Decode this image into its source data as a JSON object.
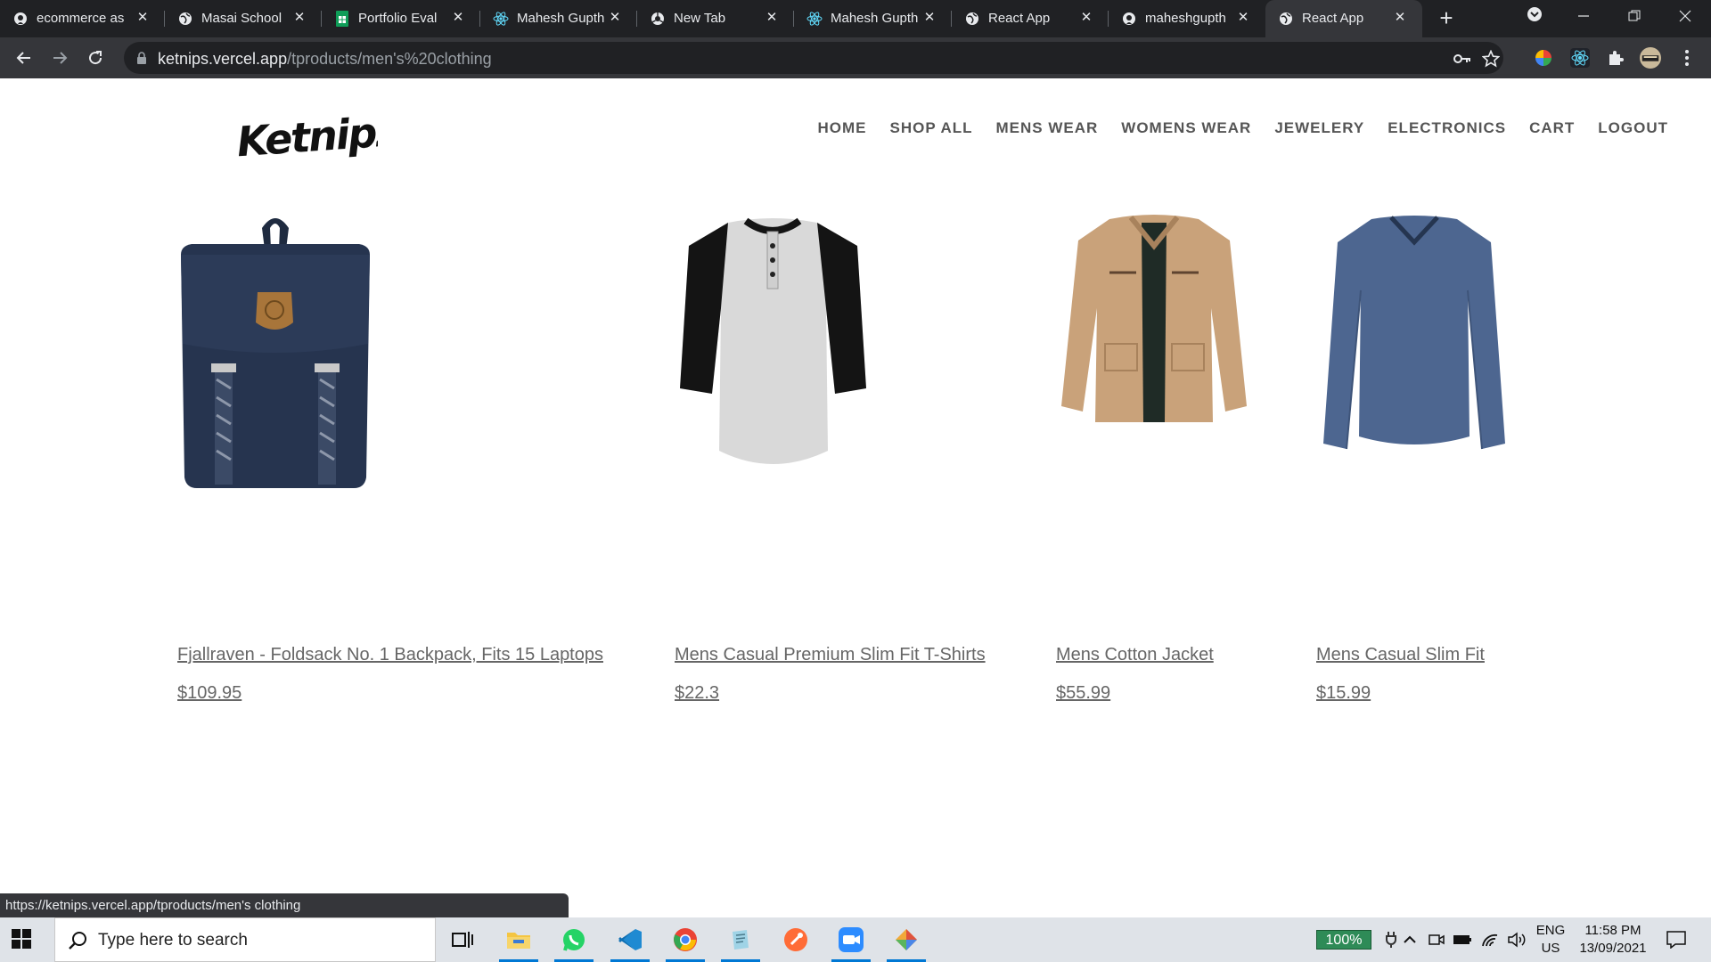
{
  "browser": {
    "tabs": [
      {
        "title": "ecommerce as",
        "favicon": "github-icon"
      },
      {
        "title": "Masai School",
        "favicon": "globe-icon"
      },
      {
        "title": "Portfolio Eval",
        "favicon": "sheets-icon"
      },
      {
        "title": "Mahesh Gupth",
        "favicon": "react-icon"
      },
      {
        "title": "New Tab",
        "favicon": "chrome-icon"
      },
      {
        "title": "Mahesh Gupth",
        "favicon": "react-icon"
      },
      {
        "title": "React App",
        "favicon": "globe-icon"
      },
      {
        "title": "maheshgupth",
        "favicon": "github-icon"
      },
      {
        "title": "React App",
        "favicon": "globe-icon",
        "active": true
      }
    ],
    "url_host": "ketnips.vercel.app",
    "url_path": "/tproducts/men's%20clothing",
    "status_url": "https://ketnips.vercel.app/tproducts/men's clothing"
  },
  "site": {
    "logo_text": "Ketnipz",
    "nav": [
      "HOME",
      "SHOP ALL",
      "MENS WEAR",
      "WOMENS WEAR",
      "JEWELERY",
      "ELECTRONICS",
      "CART",
      "LOGOUT"
    ]
  },
  "products": [
    {
      "name": "Fjallraven - Foldsack No. 1 Backpack, Fits 15 Laptops",
      "price": "$109.95",
      "image": "navy-backpack"
    },
    {
      "name": "Mens Casual Premium Slim Fit T-Shirts",
      "price": "$22.3",
      "image": "raglan-tshirt"
    },
    {
      "name": "Mens Cotton Jacket",
      "price": "$55.99",
      "image": "khaki-jacket"
    },
    {
      "name": "Mens Casual Slim Fit",
      "price": "$15.99",
      "image": "blue-longsleeve"
    }
  ],
  "taskbar": {
    "search_placeholder": "Type here to search",
    "battery": "100%",
    "lang_1": "ENG",
    "lang_2": "US",
    "time": "11:58 PM",
    "date": "13/09/2021"
  },
  "colors": {
    "tabstrip": "#202124",
    "toolbar": "#35363a",
    "nav_text": "#555555",
    "product_text": "#666666"
  }
}
